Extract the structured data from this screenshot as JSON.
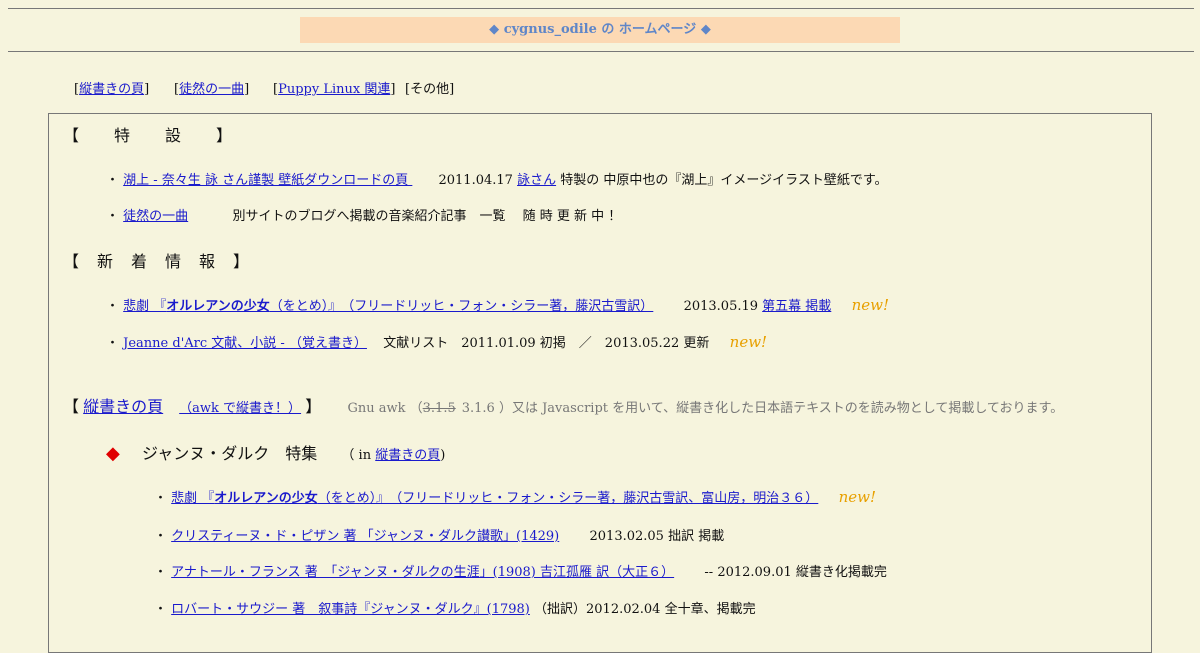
{
  "title": "◆ cygnus_odile の ホームページ ◆",
  "nav": [
    {
      "pre": "[",
      "link": "縦書きの頁",
      "post": "]"
    },
    {
      "pre": "[",
      "link": "徒然の一曲",
      "post": "]"
    },
    {
      "pre": "[",
      "link": "Puppy Linux 関連",
      "post": "]"
    },
    {
      "text": "[その他]"
    }
  ],
  "special": {
    "heading": "【　　特　　設　　】",
    "items": [
      {
        "bullet": "・",
        "link": "湖上 - 奈々生 詠 さん謹製 壁紙ダウンロードの頁 ",
        "date": "2011.04.17",
        "link2": "詠さん",
        "desc": "特製の 中原中也の『湖上』イメージイラスト壁紙です。"
      },
      {
        "bullet": "・",
        "link": "徒然の一曲",
        "desc": "別サイトのブログへ掲載の音楽紹介記事　一覧　 随 時 更 新 中 ！"
      }
    ]
  },
  "news": {
    "heading": "【　新　着　情　報　】",
    "items": [
      {
        "bullet": "・",
        "link_pre": "悲劇 『",
        "link_bold": "オルレアンの少女",
        "link_post": "（をとめ）』　（フリードリッヒ・フォン・シラー著，藤沢古雪訳）",
        "date": "2013.05.19",
        "link2": "第五幕 掲載",
        "new": "new!"
      },
      {
        "bullet": "・",
        "link": "Jeanne d'Arc 文献、小説 - （覚え書き）",
        "desc": "文献リスト　2011.01.09 初掲　／　2013.05.22 更新",
        "new": "new!"
      }
    ]
  },
  "tategaki": {
    "bracket_open": "【",
    "link": "縦書きの頁",
    "link_small": "（awk で縦書き！）",
    "bracket_close": "】",
    "desc_pre": "Gnu awk （",
    "desc_strike": "3.1.5",
    "desc_post": "3.1.6 ）又は Javascript を用いて、縦書き化した日本語テキストのを読み物として掲載しております。",
    "jeanne": {
      "diamond": "◆",
      "title": "ジャンヌ・ダルク　特集",
      "in_pre": "（ in",
      "in_link": "縦書きの頁",
      "in_post": ")"
    },
    "items": [
      {
        "bullet": "・",
        "link_pre": "悲劇 『",
        "link_bold": "オルレアンの少女",
        "link_post": "（をとめ）』　（フリードリッヒ・フォン・シラー著，藤沢古雪訳、富山房，明治３６）",
        "new": "new!"
      },
      {
        "bullet": "・",
        "link": "クリスティーヌ・ド・ピザン 著 「ジャンヌ・ダルク讃歌」(1429)",
        "desc": "2013.02.05 拙訳 掲載"
      },
      {
        "bullet": "・",
        "link": "アナトール・フランス 著　「ジャンヌ・ダルクの生涯」(1908) 吉江孤雁 訳（大正６）",
        "desc": "-- 2012.09.01 縦書き化掲載完"
      },
      {
        "bullet": "・",
        "link": "ロバート・サウジー 著　叙事詩『ジャンヌ・ダルク』(1798)",
        "desc": "（拙訳）2012.02.04 全十章、掲載完"
      }
    ]
  }
}
